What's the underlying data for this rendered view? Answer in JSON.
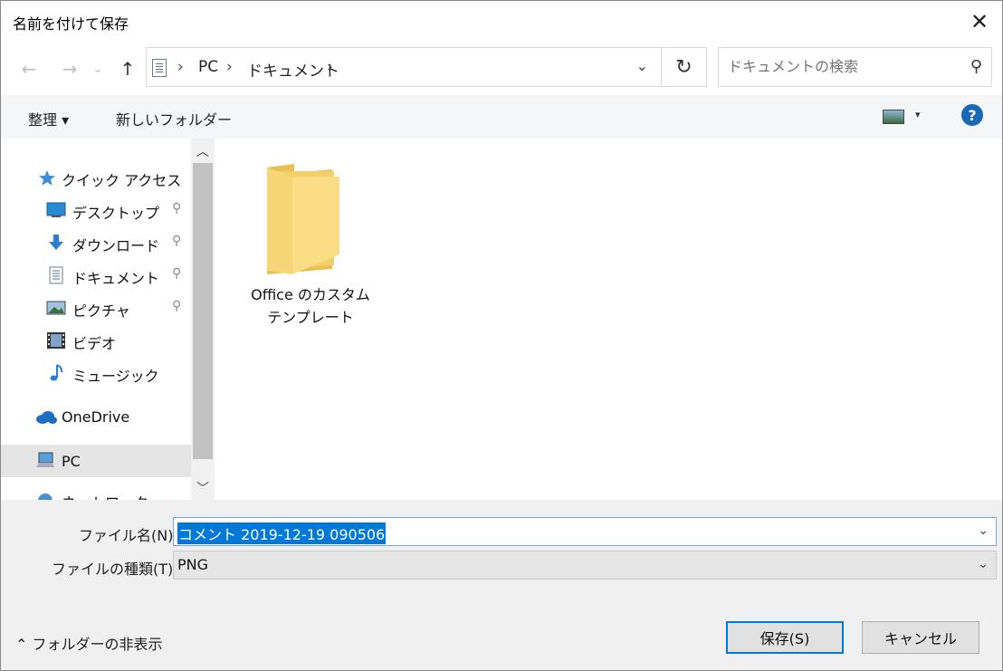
{
  "window": {
    "title": "名前を付けて保存",
    "close_glyph": "✕"
  },
  "nav": {
    "back_glyph": "←",
    "forward_glyph": "→",
    "recent_glyph": "⌄",
    "up_glyph": "↑",
    "breadcrumbs": [
      "PC",
      "ドキュメント"
    ],
    "separator": "›",
    "address_dropdown_glyph": "⌄",
    "refresh_glyph": "↻",
    "search_placeholder": "ドキュメントの検索",
    "search_icon": "⚲"
  },
  "toolbar": {
    "organize_label": "整理 ▾",
    "new_folder_label": "新しいフォルダー",
    "help_label": "?",
    "view_arrow": "▾"
  },
  "sidebar": {
    "quick_access_label": "クイック アクセス",
    "items": [
      {
        "label": "デスクトップ",
        "icon": "desktop-icon",
        "pinned": true
      },
      {
        "label": "ダウンロード",
        "icon": "download-icon",
        "pinned": true
      },
      {
        "label": "ドキュメント",
        "icon": "document-icon",
        "pinned": true
      },
      {
        "label": "ピクチャ",
        "icon": "picture-icon",
        "pinned": true
      },
      {
        "label": "ビデオ",
        "icon": "video-icon",
        "pinned": false
      },
      {
        "label": "ミュージック",
        "icon": "music-icon",
        "pinned": false
      }
    ],
    "onedrive_label": "OneDrive",
    "pc_label": "PC",
    "network_label": "ネットワーク",
    "pin_glyph": "📌",
    "scroll_up": "︿",
    "scroll_down": "﹀"
  },
  "content": {
    "items": [
      {
        "line1": "Office のカスタム",
        "line2": "テンプレート",
        "icon": "folder-icon"
      }
    ]
  },
  "form": {
    "filename_label": "ファイル名(N):",
    "filename_value": "コメント 2019-12-19 090506",
    "filetype_label": "ファイルの種類(T):",
    "filetype_value": "PNG",
    "dropdown_glyph": "⌄"
  },
  "footer": {
    "hide_folders_label": "⌃  フォルダーの非表示",
    "save_label": "保存(S)",
    "cancel_label": "キャンセル"
  }
}
